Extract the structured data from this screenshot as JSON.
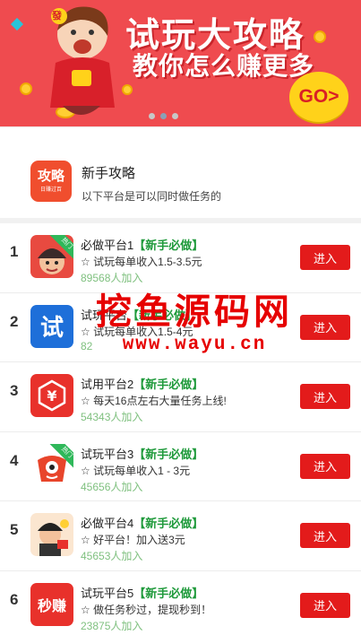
{
  "banner": {
    "title": "试玩大攻略",
    "subtitle": "教你怎么赚更多",
    "go_label": "GO>",
    "char_badge": "發"
  },
  "guide": {
    "icon_text": "攻略",
    "icon_subtext": "日赚过百",
    "title": "新手攻略",
    "description": "以下平台是可以同时做任务的"
  },
  "items": [
    {
      "rank": "1",
      "name": "必做平台1",
      "tag": "【新手必做】",
      "desc": "☆ 试玩每单收入1.5-3.5元",
      "count": "89568人加入",
      "button": "进入",
      "ribbon": "热门",
      "icon_text": ""
    },
    {
      "rank": "2",
      "name": "试玩平台",
      "tag": "【新手必做】",
      "desc": "☆ 试玩每单收入1.5-4元",
      "count": "82",
      "button": "进入",
      "ribbon": "",
      "icon_text": "试"
    },
    {
      "rank": "3",
      "name": "试用平台2",
      "tag": "【新手必做】",
      "desc": "☆ 每天16点左右大量任务上线!",
      "count": "54343人加入",
      "button": "进入",
      "ribbon": "",
      "icon_text": "¥"
    },
    {
      "rank": "4",
      "name": "试玩平台3",
      "tag": "【新手必做】",
      "desc": "☆ 试玩每单收入1 - 3元",
      "count": "45656人加入",
      "button": "进入",
      "ribbon": "热门",
      "icon_text": ""
    },
    {
      "rank": "5",
      "name": "必做平台4",
      "tag": "【新手必做】",
      "desc": "☆ 好平台！加入送3元",
      "count": "45653人加入",
      "button": "进入",
      "ribbon": "",
      "icon_text": ""
    },
    {
      "rank": "6",
      "name": "试玩平台5",
      "tag": "【新手必做】",
      "desc": "☆ 做任务秒过，提现秒到！",
      "count": "23875人加入",
      "button": "进入",
      "ribbon": "",
      "icon_text": "秒赚"
    }
  ],
  "watermark": {
    "text": "挖鱼源码网",
    "url": "www.wayu.cn"
  },
  "colors": {
    "banner_bg": "#ef4b4f",
    "button": "#e31b1b",
    "tag": "#1f9a3b",
    "count": "#7fc07f"
  }
}
